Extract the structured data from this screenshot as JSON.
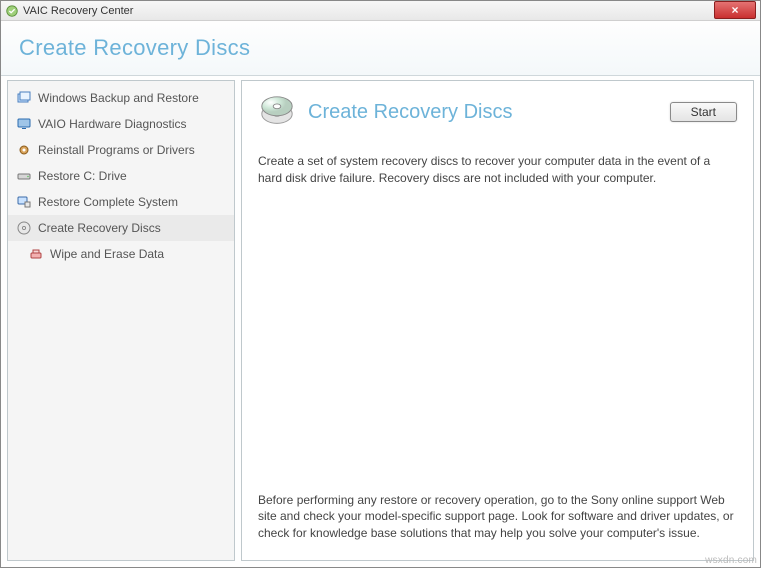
{
  "titlebar": {
    "app_title": "VAIC Recovery Center",
    "close": "×"
  },
  "header": {
    "title": "Create Recovery Discs"
  },
  "sidebar": {
    "items": [
      {
        "label": "Windows Backup and Restore",
        "icon": "window-stack-icon"
      },
      {
        "label": "VAIO Hardware Diagnostics",
        "icon": "monitor-icon"
      },
      {
        "label": "Reinstall Programs or Drivers",
        "icon": "gear-icon"
      },
      {
        "label": "Restore C: Drive",
        "icon": "drive-icon"
      },
      {
        "label": "Restore Complete System",
        "icon": "computer-icon"
      },
      {
        "label": "Create Recovery Discs",
        "icon": "disc-icon"
      },
      {
        "label": "Wipe and Erase Data",
        "icon": "erase-icon"
      }
    ]
  },
  "main": {
    "title": "Create Recovery Discs",
    "start_label": "Start",
    "description": "Create a set of system recovery discs to recover your computer data in the event of a hard disk drive failure. Recovery discs are not included with your computer.",
    "footer": "Before performing any restore or recovery operation, go to the Sony online support Web site and check your model-specific support page. Look for software and driver updates, or check for knowledge base solutions that may help you solve your computer's issue."
  },
  "watermark": "wsxdn.com"
}
